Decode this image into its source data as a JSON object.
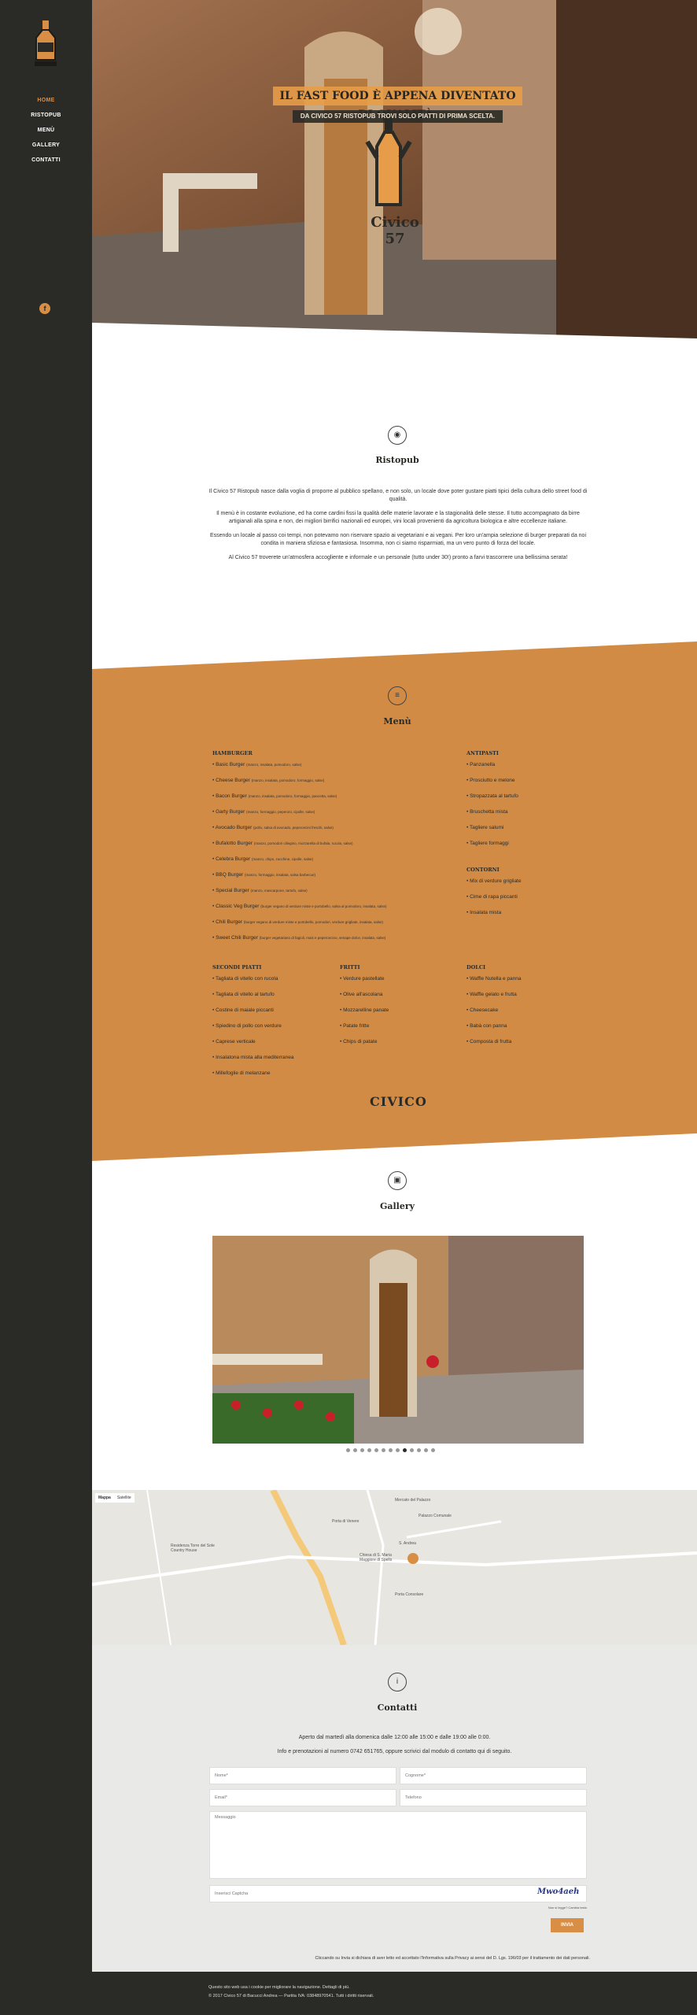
{
  "sidebar": {
    "nav": [
      {
        "label": "HOME",
        "active": true
      },
      {
        "label": "RISTOPUB",
        "active": false
      },
      {
        "label": "MENÙ",
        "active": false
      },
      {
        "label": "GALLERY",
        "active": false
      },
      {
        "label": "CONTATTI",
        "active": false
      }
    ],
    "facebook_icon": "facebook-icon",
    "facebook_glyph": "f"
  },
  "hero": {
    "title": "IL FAST FOOD È APPENA DIVENTATO DI QUALITÀ.",
    "subtitle": "DA CIVICO 57 RISTOPUB TROVI SOLO PIATTI DI PRIMA SCELTA.",
    "logo_text": "Civico 57"
  },
  "ristopub": {
    "title": "Ristopub",
    "icon": "restaurant-icon",
    "p1": "Il Civico 57 Ristopub nasce dalla voglia di proporre al pubblico spellano, e non solo, un locale dove poter gustare piatti tipici della cultura dello street food di qualità.",
    "p2": "Il menù è in costante evoluzione, ed ha come cardini fissi la qualità delle materie lavorate e la stagionalità delle stesse. Il tutto accompagnato da birre artigianali alla spina e non, dei migliori birrifici nazionali ed europei, vini locali provenienti da agricoltura biologica e altre eccellenze italiane.",
    "p3": "Essendo un locale al passo coi tempi, non potevamo non riservare spazio ai vegetariani e ai vegani. Per loro un'ampia selezione di burger preparati da noi condita in maniera sfiziosa e fantasiosa. Insomma, non ci siamo risparmiati, ma un vero punto di forza del locale.",
    "p4": "Al Civico 57 troverete un'atmosfera accogliente e informale e un personale (tutto under 30!) pronto a farvi trascorrere una bellissima serata!"
  },
  "menu": {
    "title": "Menù",
    "icon": "menu-icon",
    "hamburger": {
      "heading": "HAMBURGER",
      "items": [
        {
          "name": "Basic Burger",
          "desc": "(manzo, insalata, pomodoro, salse)"
        },
        {
          "name": "Cheese Burger",
          "desc": "(manzo, insalata, pomodoro, formaggio, salse)"
        },
        {
          "name": "Bacon Burger",
          "desc": "(manzo, insalata, pomodoro, formaggio, pancetta, salse)"
        },
        {
          "name": "Garty Burger",
          "desc": "(manzo, formaggio, peperoni, cipolle, salse)"
        },
        {
          "name": "Avocado Burger",
          "desc": "(pollo, salsa di avocado, peperoncini freschi, salse)"
        },
        {
          "name": "Bufalotto Burger",
          "desc": "(manzo, pomodori ciliegino, mozzarella di bufala, rucola, salse)"
        },
        {
          "name": "Celebra Burger",
          "desc": "(manzo, chips, zucchine, cipolle, salse)"
        },
        {
          "name": "BBQ Burger",
          "desc": "(manzo, formaggio, insalata, salsa barbecue)"
        },
        {
          "name": "Special Burger",
          "desc": "(manzo, mascarpone, tartufo, salse)"
        },
        {
          "name": "Classic Veg Burger",
          "desc": "(burger vegano di verdure miste e portobello, salsa al pomodoro, insalata, salse)"
        },
        {
          "name": "Chili Burger",
          "desc": "(burger vegano di verdure miste e portobello, pomodori, verdure grigliate, insalata, salse)"
        },
        {
          "name": "Sweet Chili Burger",
          "desc": "(burger vegetariano di fagioli, mais e peperoncino, senape dolce, insalata, salse)"
        }
      ]
    },
    "antipasti": {
      "heading": "ANTIPASTI",
      "items": [
        "Panzanella",
        "Prosciutto e melone",
        "Stropazzata al tartufo",
        "Bruschetta mista",
        "Tagliere salumi",
        "Tagliere formaggi"
      ]
    },
    "contorni": {
      "heading": "CONTORNI",
      "items": [
        "Mix di verdure grigliate",
        "Cime di rapa piccanti",
        "Insalata mista"
      ]
    },
    "secondi": {
      "heading": "SECONDI PIATTI",
      "items": [
        "Tagliata di vitello con rucola",
        "Tagliata di vitello al tartufo",
        "Costine di maiale piccanti",
        "Spiedino di pollo con verdure",
        "Caprese verticale",
        "Insalatona mista alla mediterranea",
        "Millefoglie di melanzane"
      ]
    },
    "fritti": {
      "heading": "FRITTI",
      "items": [
        "Verdure pastellate",
        "Olive all'ascolana",
        "Mozzarelline panate",
        "Patate fritte",
        "Chips di patate"
      ]
    },
    "dolci": {
      "heading": "DOLCI",
      "items": [
        "Waffle Nutella e panna",
        "Waffle gelato e frutta",
        "Cheesecake",
        "Babà con panna",
        "Composta di frutta"
      ]
    },
    "logo_text": "CIVICO"
  },
  "gallery": {
    "title": "Gallery",
    "icon": "image-icon",
    "dot_count": 13,
    "active_dot": 8
  },
  "map": {
    "tabs": [
      "Mappa",
      "Satellite"
    ],
    "places": [
      "Mercato del Palazzo",
      "Palazzo Comunale",
      "Porta di Venere",
      "Residenza Torre del Sole Country House",
      "S. Andrea",
      "Chiesa di S. Maria Maggiore di Spello",
      "Porta Consolare"
    ]
  },
  "contatti": {
    "title": "Contatti",
    "icon": "info-icon",
    "hours": "Aperto dal martedì alla domenica dalle 12:00 alle 15:00 e dalle 19:00 alle 0:00.",
    "info": "Info e prenotazioni al numero 0742 651765, oppure scrivici dal modulo di contatto qui di seguito.",
    "name_ph": "Nome*",
    "surname_ph": "Cognome*",
    "email_ph": "Email*",
    "phone_ph": "Telefono",
    "message_ph": "Messaggio",
    "captcha_ph": "Inserisci Captcha",
    "captcha_img": "Mwo4aeh",
    "captcha_hint": "Non si legge? Cambia testo",
    "send": "INVIA",
    "privacy": "Cliccando su Invia si dichiara di aver letto ed accettato l'Informativa sulla Privacy ai sensi del D. Lgs. 196/03 per il trattamento dei dati personali."
  },
  "footer": {
    "cookie": "Questo sito web usa i cookie per migliorare la navigazione. Dettagli di più.",
    "copy": "© 2017 Civico 57 di Bacucci Andrea — Partita IVA: 03848970541. Tutti i diritti riservati."
  },
  "colors": {
    "accent": "#d88e45",
    "dark": "#2a2a26"
  }
}
